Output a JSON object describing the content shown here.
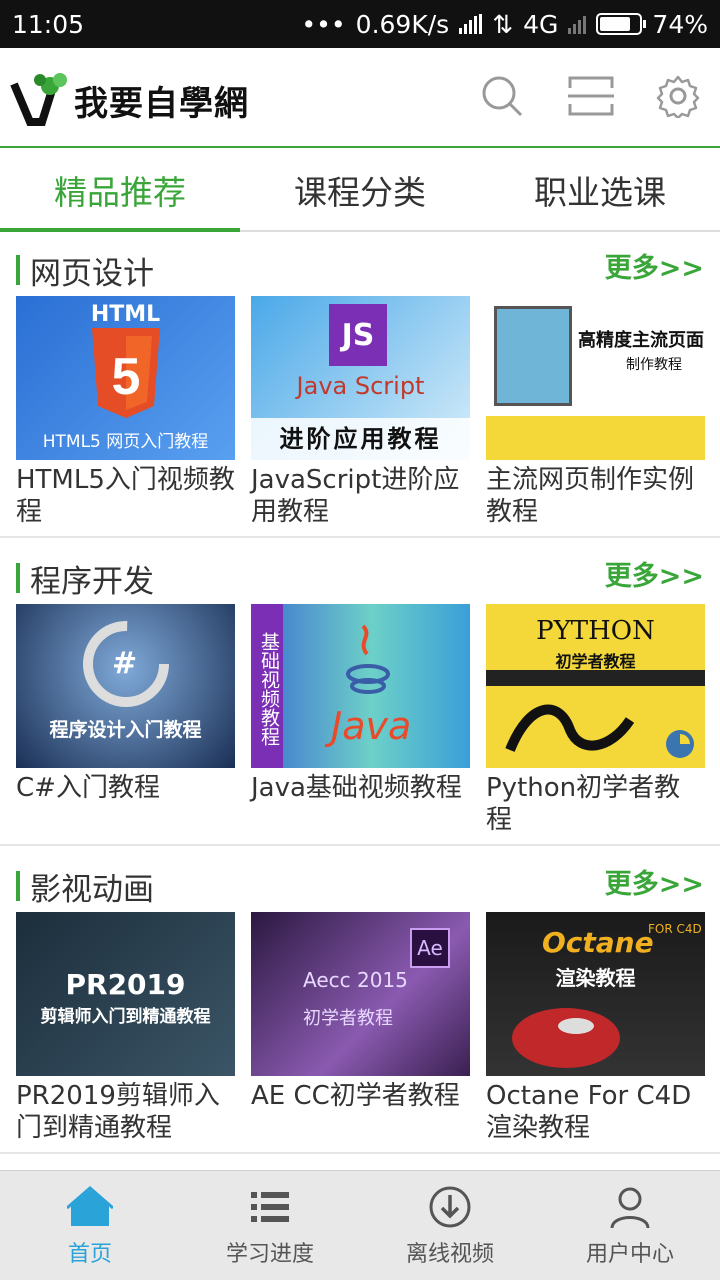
{
  "status": {
    "time": "11:05",
    "speed": "0.69K/s",
    "network": "4G",
    "battery": "74%"
  },
  "header": {
    "logo_text": "我要自學網"
  },
  "tabs": [
    "精品推荐",
    "课程分类",
    "职业选课"
  ],
  "sections": [
    {
      "title": "网页设计",
      "more": "更多>>",
      "items": [
        {
          "title": "HTML5入门视频教程",
          "thumb_text": "HTML",
          "thumb_sub": "HTML5 网页入门教程"
        },
        {
          "title": "JavaScript进阶应用教程",
          "thumb_text": "JS",
          "thumb_sub": "Java Script",
          "thumb_sub2": "进阶应用教程"
        },
        {
          "title": "主流网页制作实例教程",
          "thumb_text": "高精度主流页面",
          "thumb_sub": "制作教程"
        }
      ]
    },
    {
      "title": "程序开发",
      "more": "更多>>",
      "items": [
        {
          "title": "C#入门教程",
          "thumb_text": "#",
          "thumb_sub": "程序设计入门教程"
        },
        {
          "title": "Java基础视频教程",
          "thumb_text": "Java",
          "thumb_sub": "基础视频教程"
        },
        {
          "title": "Python初学者教程",
          "thumb_text": "PYTHON",
          "thumb_sub": "初学者教程"
        }
      ]
    },
    {
      "title": "影视动画",
      "more": "更多>>",
      "items": [
        {
          "title": "PR2019剪辑师入门到精通教程",
          "thumb_text": "PR2019",
          "thumb_sub": "剪辑师入门到精通教程"
        },
        {
          "title": "AE CC初学者教程",
          "thumb_text": "Ae",
          "thumb_sub": "初学者教程",
          "thumb_sub2": "Aecc 2015"
        },
        {
          "title": "Octane For C4D渲染教程",
          "thumb_text": "Octane",
          "thumb_sub": "渲染教程",
          "thumb_sub2": "FOR C4D"
        }
      ]
    }
  ],
  "bottom_nav": [
    "首页",
    "学习进度",
    "离线视频",
    "用户中心"
  ],
  "colors": {
    "accent": "#3aa63a",
    "nav_active": "#2aa3d8"
  }
}
